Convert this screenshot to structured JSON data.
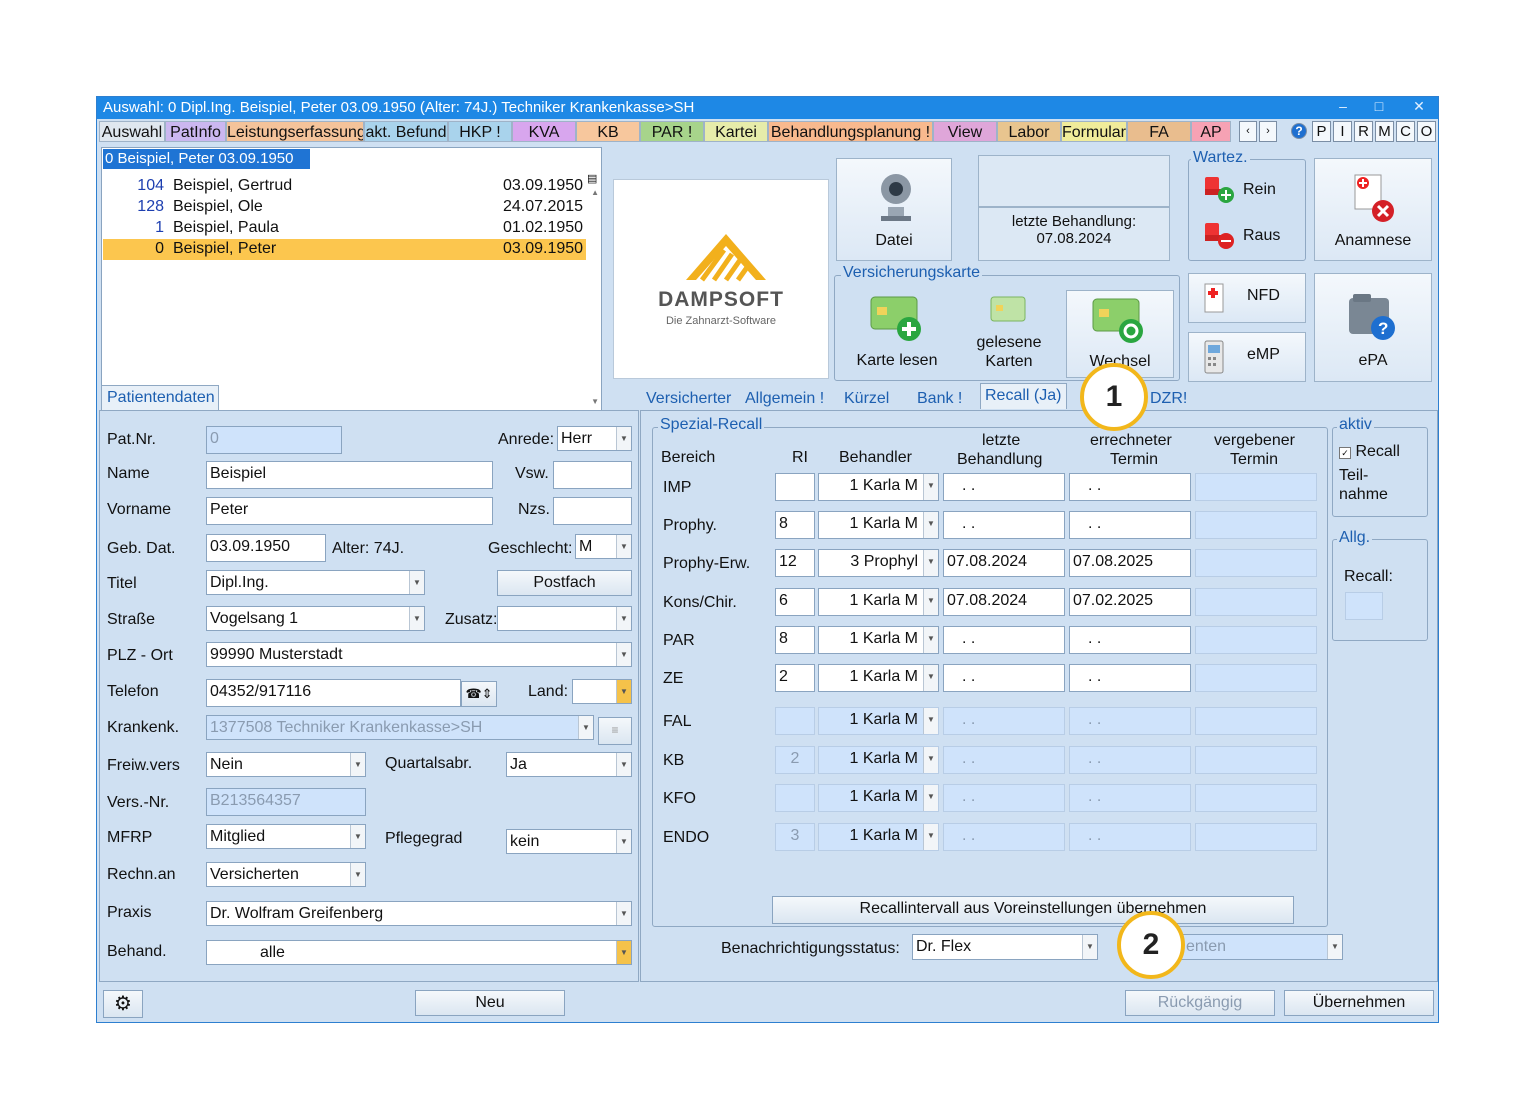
{
  "title_bar": "Auswahl: 0  Dipl.Ing. Beispiel, Peter  03.09.1950 (Alter: 74J.)  Techniker Krankenkasse>SH",
  "window_controls": {
    "minimize": "–",
    "maximize": "□",
    "close": "✕"
  },
  "tabs": [
    {
      "label": "Auswahl",
      "color": "#dfe7ef"
    },
    {
      "label": "PatInfo",
      "color": "#cbb7f0"
    },
    {
      "label": "Leistungserfassung",
      "color": "#f4c39a"
    },
    {
      "label": "akt. Befund",
      "color": "#a9d3ec"
    },
    {
      "label": "HKP !",
      "color": "#a9d3ec"
    },
    {
      "label": "KVA",
      "color": "#d8a6ee"
    },
    {
      "label": "KB",
      "color": "#f7c79d"
    },
    {
      "label": "PAR !",
      "color": "#a7d48b"
    },
    {
      "label": "Kartei",
      "color": "#e6ecaa"
    },
    {
      "label": "Behandlungsplanung !",
      "color": "#f8b98e"
    },
    {
      "label": "View",
      "color": "#dfa6d9"
    },
    {
      "label": "Labor",
      "color": "#e8c58f"
    },
    {
      "label": "Formular",
      "color": "#f0ec9a"
    },
    {
      "label": "FA",
      "color": "#e9bd8e"
    },
    {
      "label": "AP",
      "color": "#f6a2b4"
    }
  ],
  "tab_nav": {
    "prev": "‹",
    "next": "›"
  },
  "quick_buttons": [
    "?",
    "P",
    "I",
    "R",
    "M",
    "C",
    "O"
  ],
  "patient_search": "0 Beispiel, Peter  03.09.1950",
  "patients": [
    {
      "nr": "104",
      "name": "Beispiel, Gertrud",
      "dob": "03.09.1950",
      "selected": false
    },
    {
      "nr": "128",
      "name": "Beispiel, Ole",
      "dob": "24.07.2015",
      "selected": false
    },
    {
      "nr": "1",
      "name": "Beispiel, Paula",
      "dob": "01.02.1950",
      "selected": false
    },
    {
      "nr": "0",
      "name": "Beispiel, Peter",
      "dob": "03.09.1950",
      "selected": true
    }
  ],
  "logo": {
    "brand": "DAMPSOFT",
    "tagline": "Die Zahnarzt-Software"
  },
  "buttons": {
    "datei": "Datei",
    "letzte_label": "letzte Behandlung:",
    "letzte_date": "07.08.2024",
    "wartez": "Wartez.",
    "rein": "Rein",
    "raus": "Raus",
    "anamnese": "Anamnese",
    "versicherungskarte": "Versicherungskarte",
    "karte_lesen": "Karte lesen",
    "gelesene_1": "gelesene",
    "gelesene_2": "Karten",
    "wechsel": "Wechsel",
    "nfd": "NFD",
    "emp": "eMP",
    "epa": "ePA"
  },
  "left_tab": "Patientendaten",
  "right_tabs": [
    "Versicherter",
    "Allgemein !",
    "Kürzel",
    "Bank !",
    "Recall (Ja)",
    "DZR!"
  ],
  "form": {
    "patnr_label": "Pat.Nr.",
    "patnr": "0",
    "anrede_label": "Anrede:",
    "anrede": "Herr",
    "name_label": "Name",
    "name": "Beispiel",
    "vsw_label": "Vsw.",
    "vsw": "",
    "vorname_label": "Vorname",
    "vorname": "Peter",
    "nzs_label": "Nzs.",
    "nzs": "",
    "geb_label": "Geb. Dat.",
    "geb": "03.09.1950",
    "alter": "Alter: 74J.",
    "geschlecht_label": "Geschlecht:",
    "geschlecht": "M",
    "titel_label": "Titel",
    "titel": "Dipl.Ing.",
    "postfach": "Postfach",
    "strasse_label": "Straße",
    "strasse": "Vogelsang 1",
    "zusatz_label": "Zusatz:",
    "zusatz": "",
    "plz_label": "PLZ - Ort",
    "plz": "99990 Musterstadt",
    "telefon_label": "Telefon",
    "telefon": "04352/917116",
    "land_label": "Land:",
    "land": "",
    "kk_label": "Krankenk.",
    "kk": "1377508 Techniker Krankenkasse>SH",
    "freiw_label": "Freiw.vers",
    "freiw": "Nein",
    "quartal_label": "Quartalsabr.",
    "quartal": "Ja",
    "versnr_label": "Vers.-Nr.",
    "versnr": "B213564357",
    "mfrp_label": "MFRP",
    "mfrp": "Mitglied",
    "pflege_label": "Pflegegrad",
    "pflege": "kein",
    "rechn_label": "Rechn.an",
    "rechn": "Versicherten",
    "praxis_label": "Praxis",
    "praxis": "Dr. Wolfram Greifenberg",
    "behand_label": "Behand.",
    "behand": "alle"
  },
  "recall": {
    "group_title": "Spezial-Recall",
    "headers": {
      "bereich": "Bereich",
      "ri": "RI",
      "behandler": "Behandler",
      "letzte_1": "letzte",
      "letzte_2": "Behandlung",
      "err_1": "errechneter",
      "err_2": "Termin",
      "verg_1": "vergebener",
      "verg_2": "Termin"
    },
    "rows": [
      {
        "bereich": "IMP",
        "ri": "",
        "behandler": "1 Karla M",
        "letzte": " .  .",
        "errechnet": " .  .",
        "vergeben": "",
        "enabled": true
      },
      {
        "bereich": "Prophy.",
        "ri": "8",
        "behandler": "1 Karla M",
        "letzte": " .  .",
        "errechnet": " .  .",
        "vergeben": "",
        "enabled": true
      },
      {
        "bereich": "Prophy-Erw.",
        "ri": "12",
        "behandler": "3 Prophyl",
        "letzte": "07.08.2024",
        "errechnet": "07.08.2025",
        "vergeben": "",
        "enabled": true
      },
      {
        "bereich": "Kons/Chir.",
        "ri": "6",
        "behandler": "1 Karla M",
        "letzte": "07.08.2024",
        "errechnet": "07.02.2025",
        "vergeben": "",
        "enabled": true
      },
      {
        "bereich": "PAR",
        "ri": "8",
        "behandler": "1 Karla M",
        "letzte": " .  .",
        "errechnet": " .  .",
        "vergeben": "",
        "enabled": true
      },
      {
        "bereich": "ZE",
        "ri": "2",
        "behandler": "1 Karla M",
        "letzte": " .  .",
        "errechnet": " .  .",
        "vergeben": "",
        "enabled": true
      },
      {
        "bereich": "FAL",
        "ri": "",
        "behandler": "1 Karla M",
        "letzte": " .  .",
        "errechnet": " .  .",
        "vergeben": "",
        "enabled": false
      },
      {
        "bereich": "KB",
        "ri": "2",
        "behandler": "1 Karla M",
        "letzte": " .  .",
        "errechnet": " .  .",
        "vergeben": "",
        "enabled": false
      },
      {
        "bereich": "KFO",
        "ri": "",
        "behandler": "1 Karla M",
        "letzte": " .  .",
        "errechnet": " .  .",
        "vergeben": "",
        "enabled": false
      },
      {
        "bereich": "ENDO",
        "ri": "3",
        "behandler": "1 Karla M",
        "letzte": " .  .",
        "errechnet": " .  .",
        "vergeben": "",
        "enabled": false
      }
    ],
    "uebernehmen_intervall": "Recallintervall aus Voreinstellungen übernehmen",
    "benachrichtigung_label": "Benachrichtigungsstatus:",
    "benachrichtigung": "Dr. Flex",
    "second_combo": "enten",
    "aktiv_title": "aktiv",
    "recall_check": "Recall",
    "teil_1": "Teil-",
    "teil_2": "nahme",
    "allg_title": "Allg.",
    "allg_recall": "Recall:"
  },
  "bottom": {
    "neu": "Neu",
    "rueckgaengig": "Rückgängig",
    "uebernehmen": "Übernehmen"
  },
  "callouts": [
    "1",
    "2"
  ]
}
